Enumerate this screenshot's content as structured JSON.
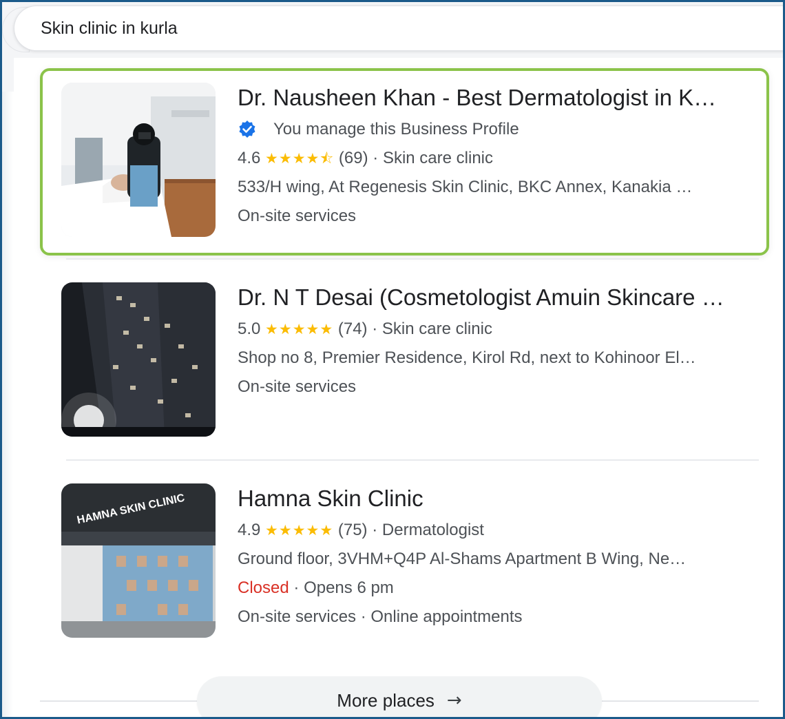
{
  "search": {
    "query": "Skin clinic in kurla"
  },
  "results": [
    {
      "title": "Dr. Nausheen Khan - Best Dermatologist in K…",
      "verified_text": "You manage this Business Profile",
      "rating": "4.6",
      "stars": "★★★★⯪",
      "reviews": "(69)",
      "category": "Skin care clinic",
      "address": "533/H wing, At Regenesis Skin Clinic, BKC Annex, Kanakia …",
      "services": "On-site services",
      "icon": "verified-badge-icon"
    },
    {
      "title": "Dr. N T Desai (Cosmetologist Amuin Skincare …",
      "rating": "5.0",
      "stars": "★★★★★",
      "reviews": "(74)",
      "category": "Skin care clinic",
      "address": "Shop no 8, Premier Residence, Kirol Rd, next to Kohinoor El…",
      "services": "On-site services"
    },
    {
      "title": "Hamna Skin Clinic",
      "rating": "4.9",
      "stars": "★★★★★",
      "reviews": "(75)",
      "category": "Dermatologist",
      "address": "Ground floor, 3VHM+Q4P Al-Shams Apartment B Wing, Ne…",
      "status": "Closed",
      "hours": "Opens 6 pm",
      "services": "On-site services",
      "services2": "Online appointments",
      "sign_text": "HAMNA SKIN CLINIC"
    }
  ],
  "separator": "·",
  "more_places": {
    "label": "More places",
    "arrow": "→"
  },
  "colors": {
    "highlight_border": "#8bc34a",
    "star": "#fbbc04",
    "closed": "#d93025",
    "verified": "#1a73e8"
  }
}
